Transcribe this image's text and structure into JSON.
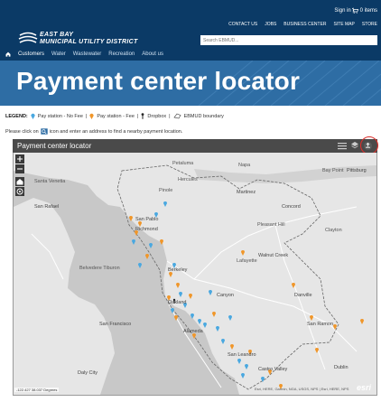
{
  "header": {
    "signin": "Sign in |",
    "cart": "0 items",
    "topnav": [
      "CONTACT US",
      "JOBS",
      "BUSINESS CENTER",
      "SITE MAP",
      "STORE"
    ],
    "logo_line1": "EAST BAY",
    "logo_line2": "MUNICIPAL UTILITY DISTRICT",
    "search_placeholder": "Search EBMUD...",
    "mainnav": [
      "Customers",
      "Water",
      "Wastewater",
      "Recreation",
      "About us"
    ]
  },
  "banner": {
    "title": "Payment center locator"
  },
  "legend": {
    "label": "LEGEND:",
    "nofee": "Pay station - No Fee",
    "fee": "Pay station - Fee",
    "dropbox": "Dropbox",
    "boundary": "EBMUD boundary",
    "sep": "|"
  },
  "instructions": {
    "before": "Please click on",
    "after": "icon and enter an address to find a nearby payment location."
  },
  "map": {
    "title": "Payment center locator",
    "zoom_in": "+",
    "zoom_out": "−",
    "coords": "-122.427 38.037 Degrees",
    "attribution": "Esri, HERE, Garmin, NGA, USGS, NPS | Esri, HERE, NPS",
    "esri": "esri",
    "labels": {
      "petaluma": "Petaluma",
      "napa": "Napa",
      "santa_venetia": "Santa Venetia",
      "san_rafael": "San Rafael",
      "pinole": "Pinole",
      "hercules": "Hercules",
      "martinez": "Martinez",
      "bay_point": "Bay Point",
      "pittsburg": "Pittsburg",
      "san_pablo": "San Pablo",
      "richmond": "Richmond",
      "concord": "Concord",
      "pleasant_hill": "Pleasant Hill",
      "clayton": "Clayton",
      "lafayette": "Lafayette",
      "walnut_creek": "Walnut Creek",
      "berkeley": "Berkeley",
      "belvedere": "Belvedere Tiburon",
      "canyon": "Canyon",
      "danville": "Danville",
      "oakland": "Oakland",
      "san_francisco": "San Francisco",
      "alameda": "Alameda",
      "san_ramon": "San Ramon",
      "san_leandro": "San Leandro",
      "castro_valley": "Castro Valley",
      "dublin": "Dublin",
      "daly_city": "Daly City"
    }
  },
  "colors": {
    "header_bg": "#0b3a66",
    "banner_bg": "#2e6da4",
    "pin_nofee": "#4aa8e0",
    "pin_fee": "#f0962a",
    "water": "#c8c8c8",
    "land": "#e6e6e6"
  },
  "icons": [
    "home-icon",
    "locate-icon",
    "list-icon",
    "layers-icon",
    "share-icon",
    "cart-icon",
    "search-address-icon"
  ]
}
